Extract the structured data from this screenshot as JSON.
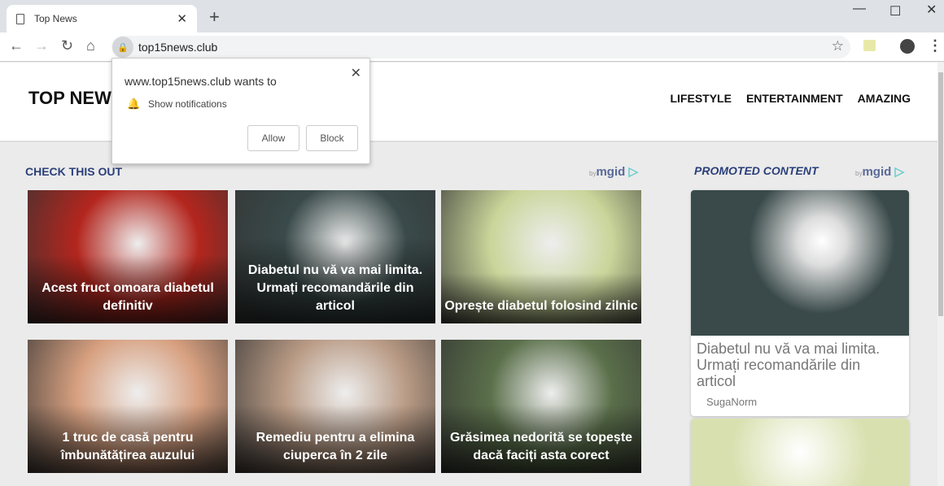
{
  "browser": {
    "tab_title": "Top News",
    "url": "top15news.club"
  },
  "site": {
    "logo": "TOP NEWS",
    "nav": [
      "LIFESTYLE",
      "ENTERTAINMENT",
      "AMAZING"
    ]
  },
  "widget": {
    "heading": "CHECK THIS OUT",
    "by": "by",
    "brand": "mgid",
    "brand_mark": "▷",
    "cards": [
      {
        "caption": "Acest fruct omoara diabetul definitiv",
        "color": "#b3261e"
      },
      {
        "caption": "Diabetul nu vă va mai limita. Urmați recomandările din articol",
        "color": "#3a4a4a"
      },
      {
        "caption": "Oprește diabetul folosind zilnic",
        "color": "#c9d59a"
      },
      {
        "caption": "1 truc de casă pentru îmbunătățirea auzului",
        "color": "#d7a080"
      },
      {
        "caption": "Remediu pentru a elimina ciuperca în 2 zile",
        "color": "#b99b85"
      },
      {
        "caption": "Grăsimea nedorită se topește dacă faciți asta corect",
        "color": "#5a6f4a"
      }
    ]
  },
  "promoted": {
    "heading": "PROMOTED CONTENT",
    "by": "by",
    "brand": "mgid",
    "brand_mark": "▷",
    "items": [
      {
        "title": "Diabetul nu vă va mai limita. Urmați recomandările din articol",
        "source": "SugaNorm",
        "color": "#3a4a4a"
      },
      {
        "color": "#d9e0b0"
      }
    ]
  },
  "popup": {
    "title": "www.top15news.club wants to",
    "permission": "Show notifications",
    "allow": "Allow",
    "block": "Block"
  }
}
